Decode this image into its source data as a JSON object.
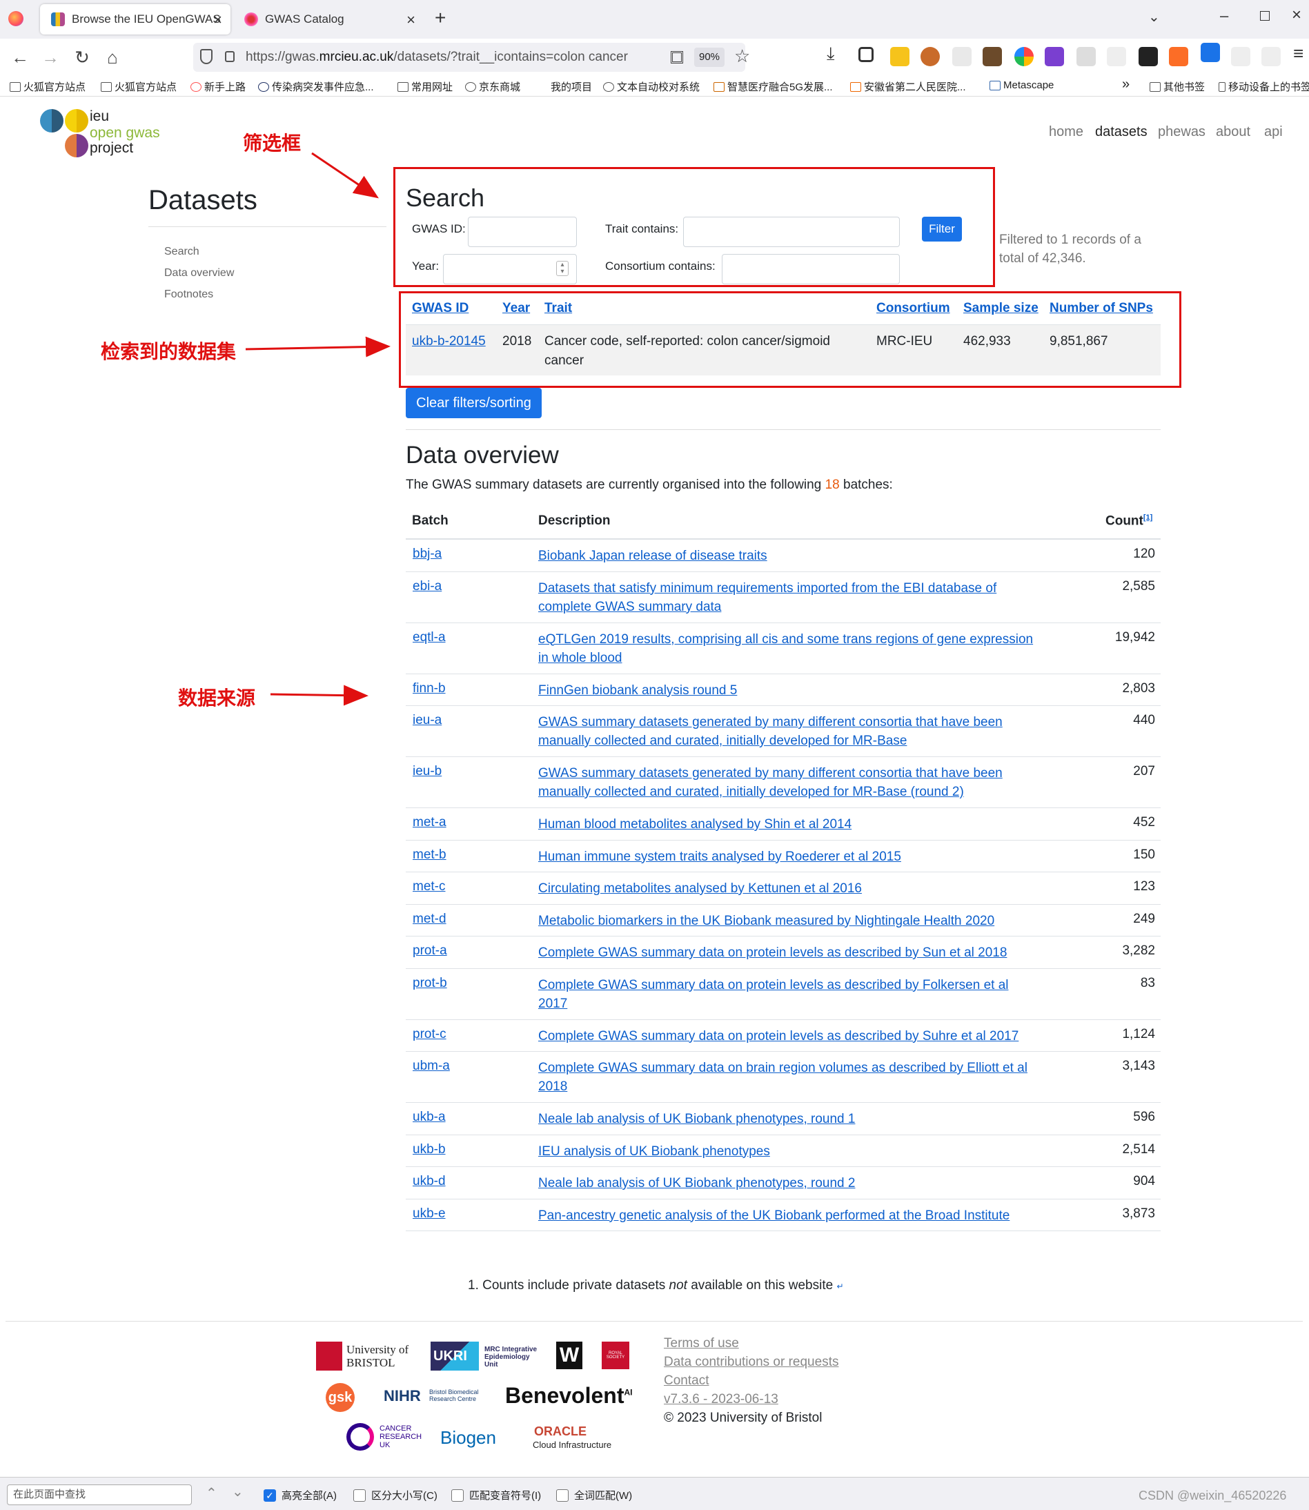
{
  "browser": {
    "tabs": [
      {
        "label": "Browse the IEU OpenGWAS",
        "active": true
      },
      {
        "label": "GWAS Catalog",
        "active": false
      }
    ],
    "url_prefix": "https://gwas.",
    "url_domain": "mrcieu.ac.uk",
    "url_suffix": "/datasets/?trait__icontains=colon cancer",
    "zoom": "90%",
    "bookmarks": [
      "火狐官方站点",
      "火狐官方站点",
      "新手上路",
      "传染病突发事件应急...",
      "常用网址",
      "京东商城",
      "我的项目",
      "文本自动校对系统",
      "智慧医疗融合5G发展...",
      "安徽省第二人民医院...",
      "Metascape",
      "其他书签",
      "移动设备上的书签"
    ]
  },
  "logo": {
    "line1": "ieu",
    "line2": "open gwas",
    "line3": "project"
  },
  "topnav": [
    "home",
    "datasets",
    "phewas",
    "about",
    "api"
  ],
  "sidebar": {
    "title": "Datasets",
    "links": [
      "Search",
      "Data overview",
      "Footnotes"
    ]
  },
  "search": {
    "title": "Search",
    "gwas_id_label": "GWAS ID:",
    "trait_label": "Trait contains:",
    "year_label": "Year:",
    "consortium_label": "Consortium contains:",
    "filter_button": "Filter",
    "filtered_info": "Filtered to 1 records of a total of 42,346."
  },
  "results": {
    "headers": [
      "GWAS ID",
      "Year",
      "Trait",
      "Consortium",
      "Sample size",
      "Number of SNPs"
    ],
    "rows": [
      {
        "id": "ukb-b-20145",
        "year": "2018",
        "trait": "Cancer code, self-reported: colon cancer/sigmoid cancer",
        "consortium": "MRC-IEU",
        "sample_size": "462,933",
        "snps": "9,851,867"
      }
    ],
    "clear_button": "Clear filters/sorting"
  },
  "overview": {
    "title": "Data overview",
    "intro_before": "The GWAS summary datasets are currently organised into the following",
    "batch_count": "18",
    "intro_after": "batches:",
    "headers": {
      "batch": "Batch",
      "description": "Description",
      "count": "Count",
      "count_note": "[1]"
    },
    "rows": [
      {
        "batch": "bbj-a",
        "description": "Biobank Japan release of disease traits",
        "count": "120"
      },
      {
        "batch": "ebi-a",
        "description": "Datasets that satisfy minimum requirements imported from the EBI database of complete GWAS summary data",
        "count": "2,585"
      },
      {
        "batch": "eqtl-a",
        "description": "eQTLGen 2019 results, comprising all cis and some trans regions of gene expression in whole blood",
        "count": "19,942"
      },
      {
        "batch": "finn-b",
        "description": "FinnGen biobank analysis round 5",
        "count": "2,803"
      },
      {
        "batch": "ieu-a",
        "description": "GWAS summary datasets generated by many different consortia that have been manually collected and curated, initially developed for MR-Base",
        "count": "440"
      },
      {
        "batch": "ieu-b",
        "description": "GWAS summary datasets generated by many different consortia that have been manually collected and curated, initially developed for MR-Base (round 2)",
        "count": "207"
      },
      {
        "batch": "met-a",
        "description": "Human blood metabolites analysed by Shin et al 2014",
        "count": "452"
      },
      {
        "batch": "met-b",
        "description": "Human immune system traits analysed by Roederer et al 2015",
        "count": "150"
      },
      {
        "batch": "met-c",
        "description": "Circulating metabolites analysed by Kettunen et al 2016",
        "count": "123"
      },
      {
        "batch": "met-d",
        "description": "Metabolic biomarkers in the UK Biobank measured by Nightingale Health 2020",
        "count": "249"
      },
      {
        "batch": "prot-a",
        "description": "Complete GWAS summary data on protein levels as described by Sun et al 2018",
        "count": "3,282"
      },
      {
        "batch": "prot-b",
        "description": "Complete GWAS summary data on protein levels as described by Folkersen et al 2017",
        "count": "83"
      },
      {
        "batch": "prot-c",
        "description": "Complete GWAS summary data on protein levels as described by Suhre et al 2017",
        "count": "1,124"
      },
      {
        "batch": "ubm-a",
        "description": "Complete GWAS summary data on brain region volumes as described by Elliott et al 2018",
        "count": "3,143"
      },
      {
        "batch": "ukb-a",
        "description": "Neale lab analysis of UK Biobank phenotypes, round 1",
        "count": "596"
      },
      {
        "batch": "ukb-b",
        "description": "IEU analysis of UK Biobank phenotypes",
        "count": "2,514"
      },
      {
        "batch": "ukb-d",
        "description": "Neale lab analysis of UK Biobank phenotypes, round 2",
        "count": "904"
      },
      {
        "batch": "ukb-e",
        "description": "Pan-ancestry genetic analysis of the UK Biobank performed at the Broad Institute",
        "count": "3,873"
      }
    ],
    "footnote_before": "1. Counts include private datasets",
    "footnote_em": "not",
    "footnote_after": "available on this website"
  },
  "footer": {
    "logos": {
      "bristol": "University of BRISTOL",
      "ukri": "UKRI",
      "mrc": "MRC Integrative Epidemiology Unit",
      "wellcome": "W",
      "royal": "ROYAL SOCIETY",
      "gsk": "gsk",
      "nihr": "NIHR",
      "nihr_sub": "Bristol Biomedical Research Centre",
      "benevolent": "Benevolent",
      "benevolent_sup": "AI",
      "cancer": "CANCER RESEARCH UK",
      "biogen": "Biogen",
      "oracle": "ORACLE",
      "oracle_sub": "Cloud Infrastructure"
    },
    "links": [
      "Terms of use",
      "Data contributions or requests",
      "Contact",
      "v7.3.6 - 2023-06-13"
    ],
    "copyright": "© 2023 University of Bristol"
  },
  "findbar": {
    "placeholder": "在此页面中查找",
    "options": [
      {
        "label": "高亮全部(A)",
        "checked": true
      },
      {
        "label": "区分大小写(C)",
        "checked": false
      },
      {
        "label": "匹配变音符号(I)",
        "checked": false
      },
      {
        "label": "全词匹配(W)",
        "checked": false
      }
    ],
    "watermark": "CSDN @weixin_46520226"
  },
  "annotations": {
    "filter_box": "筛选框",
    "datasets_found": "检索到的数据集",
    "data_source": "数据来源"
  },
  "colors": {
    "link": "#0d5fcc",
    "button": "#1a73e8",
    "annotation": "#e01010",
    "batch_count": "#e8590c"
  }
}
